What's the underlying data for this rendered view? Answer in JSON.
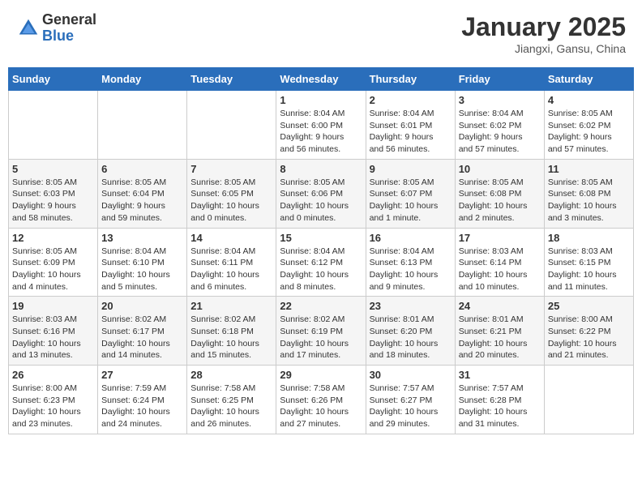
{
  "header": {
    "logo": {
      "general": "General",
      "blue": "Blue"
    },
    "title": "January 2025",
    "subtitle": "Jiangxi, Gansu, China"
  },
  "weekdays": [
    "Sunday",
    "Monday",
    "Tuesday",
    "Wednesday",
    "Thursday",
    "Friday",
    "Saturday"
  ],
  "weeks": [
    [
      {
        "day": "",
        "info": ""
      },
      {
        "day": "",
        "info": ""
      },
      {
        "day": "",
        "info": ""
      },
      {
        "day": "1",
        "info": "Sunrise: 8:04 AM\nSunset: 6:00 PM\nDaylight: 9 hours\nand 56 minutes."
      },
      {
        "day": "2",
        "info": "Sunrise: 8:04 AM\nSunset: 6:01 PM\nDaylight: 9 hours\nand 56 minutes."
      },
      {
        "day": "3",
        "info": "Sunrise: 8:04 AM\nSunset: 6:02 PM\nDaylight: 9 hours\nand 57 minutes."
      },
      {
        "day": "4",
        "info": "Sunrise: 8:05 AM\nSunset: 6:02 PM\nDaylight: 9 hours\nand 57 minutes."
      }
    ],
    [
      {
        "day": "5",
        "info": "Sunrise: 8:05 AM\nSunset: 6:03 PM\nDaylight: 9 hours\nand 58 minutes."
      },
      {
        "day": "6",
        "info": "Sunrise: 8:05 AM\nSunset: 6:04 PM\nDaylight: 9 hours\nand 59 minutes."
      },
      {
        "day": "7",
        "info": "Sunrise: 8:05 AM\nSunset: 6:05 PM\nDaylight: 10 hours\nand 0 minutes."
      },
      {
        "day": "8",
        "info": "Sunrise: 8:05 AM\nSunset: 6:06 PM\nDaylight: 10 hours\nand 0 minutes."
      },
      {
        "day": "9",
        "info": "Sunrise: 8:05 AM\nSunset: 6:07 PM\nDaylight: 10 hours\nand 1 minute."
      },
      {
        "day": "10",
        "info": "Sunrise: 8:05 AM\nSunset: 6:08 PM\nDaylight: 10 hours\nand 2 minutes."
      },
      {
        "day": "11",
        "info": "Sunrise: 8:05 AM\nSunset: 6:08 PM\nDaylight: 10 hours\nand 3 minutes."
      }
    ],
    [
      {
        "day": "12",
        "info": "Sunrise: 8:05 AM\nSunset: 6:09 PM\nDaylight: 10 hours\nand 4 minutes."
      },
      {
        "day": "13",
        "info": "Sunrise: 8:04 AM\nSunset: 6:10 PM\nDaylight: 10 hours\nand 5 minutes."
      },
      {
        "day": "14",
        "info": "Sunrise: 8:04 AM\nSunset: 6:11 PM\nDaylight: 10 hours\nand 6 minutes."
      },
      {
        "day": "15",
        "info": "Sunrise: 8:04 AM\nSunset: 6:12 PM\nDaylight: 10 hours\nand 8 minutes."
      },
      {
        "day": "16",
        "info": "Sunrise: 8:04 AM\nSunset: 6:13 PM\nDaylight: 10 hours\nand 9 minutes."
      },
      {
        "day": "17",
        "info": "Sunrise: 8:03 AM\nSunset: 6:14 PM\nDaylight: 10 hours\nand 10 minutes."
      },
      {
        "day": "18",
        "info": "Sunrise: 8:03 AM\nSunset: 6:15 PM\nDaylight: 10 hours\nand 11 minutes."
      }
    ],
    [
      {
        "day": "19",
        "info": "Sunrise: 8:03 AM\nSunset: 6:16 PM\nDaylight: 10 hours\nand 13 minutes."
      },
      {
        "day": "20",
        "info": "Sunrise: 8:02 AM\nSunset: 6:17 PM\nDaylight: 10 hours\nand 14 minutes."
      },
      {
        "day": "21",
        "info": "Sunrise: 8:02 AM\nSunset: 6:18 PM\nDaylight: 10 hours\nand 15 minutes."
      },
      {
        "day": "22",
        "info": "Sunrise: 8:02 AM\nSunset: 6:19 PM\nDaylight: 10 hours\nand 17 minutes."
      },
      {
        "day": "23",
        "info": "Sunrise: 8:01 AM\nSunset: 6:20 PM\nDaylight: 10 hours\nand 18 minutes."
      },
      {
        "day": "24",
        "info": "Sunrise: 8:01 AM\nSunset: 6:21 PM\nDaylight: 10 hours\nand 20 minutes."
      },
      {
        "day": "25",
        "info": "Sunrise: 8:00 AM\nSunset: 6:22 PM\nDaylight: 10 hours\nand 21 minutes."
      }
    ],
    [
      {
        "day": "26",
        "info": "Sunrise: 8:00 AM\nSunset: 6:23 PM\nDaylight: 10 hours\nand 23 minutes."
      },
      {
        "day": "27",
        "info": "Sunrise: 7:59 AM\nSunset: 6:24 PM\nDaylight: 10 hours\nand 24 minutes."
      },
      {
        "day": "28",
        "info": "Sunrise: 7:58 AM\nSunset: 6:25 PM\nDaylight: 10 hours\nand 26 minutes."
      },
      {
        "day": "29",
        "info": "Sunrise: 7:58 AM\nSunset: 6:26 PM\nDaylight: 10 hours\nand 27 minutes."
      },
      {
        "day": "30",
        "info": "Sunrise: 7:57 AM\nSunset: 6:27 PM\nDaylight: 10 hours\nand 29 minutes."
      },
      {
        "day": "31",
        "info": "Sunrise: 7:57 AM\nSunset: 6:28 PM\nDaylight: 10 hours\nand 31 minutes."
      },
      {
        "day": "",
        "info": ""
      }
    ]
  ]
}
